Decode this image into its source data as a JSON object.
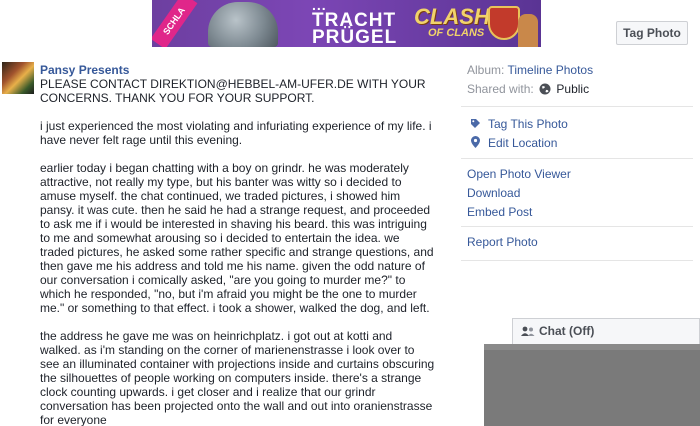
{
  "banner": {
    "ribbon_text": "SCHLA",
    "line1": "...",
    "line2": "TRACHT",
    "line3": "PRÜGEL",
    "brand_word1": "CLASH",
    "brand_word2": "OF CLANS"
  },
  "photo": {
    "tag_button_label": "Tag Photo"
  },
  "post": {
    "author": "Pansy Presents",
    "paragraphs": [
      "PLEASE CONTACT DIREKTION@HEBBEL-AM-UFER.DE WITH YOUR CONCERNS. THANK YOU FOR YOUR SUPPORT.",
      "i just experienced the most violating and infuriating experience of my life. i have never felt rage until this evening.",
      "earlier today i began chatting with a boy on grindr. he was moderately attractive, not really my type, but his banter was witty so i decided to amuse myself. the chat continued, we traded pictures, i showed him pansy. it was cute. then he said he had a strange request, and proceeded to ask me if i would be interested in shaving his beard. this was intriguing to me and somewhat arousing so i decided to entertain the idea. we traded pictures, he asked some rather specific and strange questions, and then gave me his address and told me his name. given the odd nature of our conversation i comically asked, \"are you going to murder me?\" to which he responded, \"no, but i'm afraid you might be the one to murder me.\" or something to that effect. i took a shower, walked the dog, and left.",
      "the address he gave me was on heinrichplatz. i got out at kotti and walked. as i'm standing on the corner of marienenstrasse i look over to see an illuminated container with projections inside and curtains obscuring the silhouettes of people working on computers inside. there's a strange clock counting upwards. i get closer and i realize that our grindr conversation has been projected onto the wall and out into oranienstrasse for everyone"
    ]
  },
  "sidebar": {
    "album_prefix": "Album:",
    "album_link": "Timeline Photos",
    "shared_prefix": "Shared with:",
    "shared_value": "Public",
    "tag_this_photo": "Tag This Photo",
    "edit_location": "Edit Location",
    "open_photo_viewer": "Open Photo Viewer",
    "download": "Download",
    "embed_post": "Embed Post",
    "report_photo": "Report Photo"
  },
  "chat": {
    "label": "Chat (Off)"
  },
  "colors": {
    "link": "#365899",
    "muted": "#90949c",
    "text": "#1d2129"
  }
}
